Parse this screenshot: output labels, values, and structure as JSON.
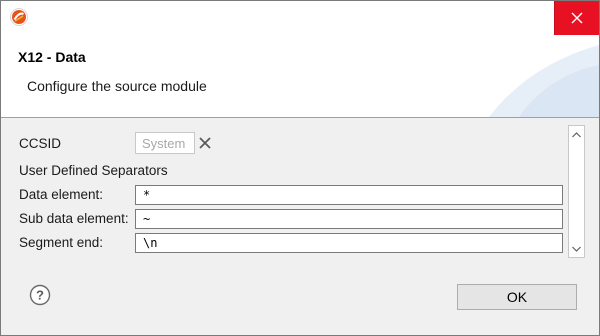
{
  "window": {
    "close_symbol": "✕"
  },
  "header": {
    "title": "X12 - Data",
    "description": "Configure the source module"
  },
  "form": {
    "ccsid": {
      "label": "CCSID",
      "placeholder": "System"
    },
    "separators_heading": "User Defined Separators",
    "fields": [
      {
        "label": "Data element:",
        "value": "*"
      },
      {
        "label": "Sub data element:",
        "value": "~"
      },
      {
        "label": "Segment end:",
        "value": "\\n"
      }
    ]
  },
  "footer": {
    "help_symbol": "?",
    "ok_label": "OK"
  },
  "colors": {
    "close_button": "#e81123",
    "accent": "#e8531b",
    "window_bg": "#f0f0f0"
  },
  "icons": {
    "app": "app-logo-icon",
    "close": "close-icon",
    "clear": "clear-x-icon",
    "help": "help-icon",
    "scroll_up": "scroll-up-arrow-icon",
    "scroll_down": "scroll-down-arrow-icon"
  }
}
